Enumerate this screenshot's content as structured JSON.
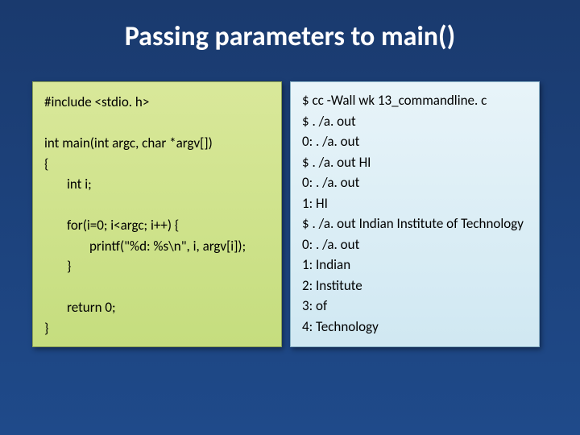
{
  "title": "Passing parameters to main()",
  "code": {
    "line1": "#include <stdio. h>",
    "line2": "int main(int argc, char *argv[])",
    "line3": "{",
    "line4": "int i;",
    "line5": "for(i=0; i<argc; i++) {",
    "line6": "printf(\"%d: %s\\n\", i, argv[i]);",
    "line7": "}",
    "line8": "return 0;",
    "line9": "}"
  },
  "output": {
    "line1": "$ cc -Wall wk 13_commandline. c",
    "line2": "$ . /a. out",
    "line3": "0: . /a. out",
    "line4": "$ . /a. out HI",
    "line5": "0: . /a. out",
    "line6": "1: HI",
    "line7": "$ . /a. out Indian Institute of Technology",
    "line8": "0: . /a. out",
    "line9": "1: Indian",
    "line10": "2: Institute",
    "line11": "3: of",
    "line12": "4: Technology"
  }
}
